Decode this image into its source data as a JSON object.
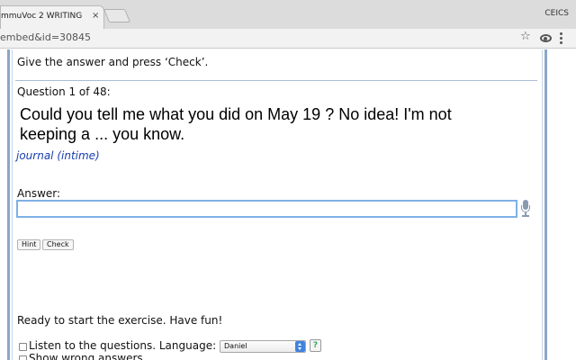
{
  "browser": {
    "tab_title": "mmuVoc 2 WRITING",
    "tab_close": "×",
    "profile_name": "CEICS",
    "url": "embed&id=30845",
    "star_glyph": "☆"
  },
  "exercise": {
    "instruction": "Give the answer and press ‘Check’.",
    "question_counter": "Question 1 of 48:",
    "question_text": "Could you tell me what you did on May 19 ? No idea! I'm not keeping a ... you know.",
    "hint_text": "journal (intime)",
    "answer_label": "Answer:",
    "answer_value": "",
    "hint_button": "Hint",
    "check_button": "Check",
    "status": "Ready to start the exercise. Have fun!"
  },
  "options": {
    "listen_label": "Listen to the questions. Language:",
    "language_selected": "Daniel",
    "help_glyph": "?",
    "show_wrong_label": "Show wrong answers"
  },
  "colors": {
    "frame_border": "#8aa6c8",
    "hint_text": "#1a3eb0",
    "input_focus": "#7fb0e6",
    "select_arrow": "#3f82e0"
  }
}
